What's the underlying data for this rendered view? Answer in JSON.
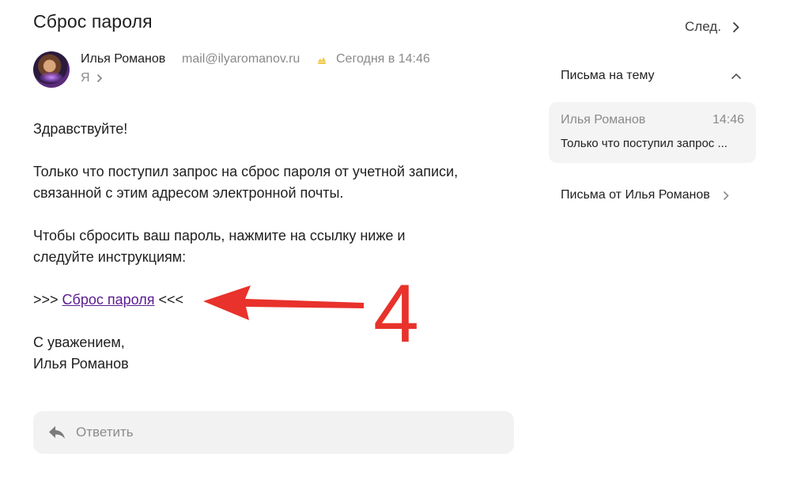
{
  "email": {
    "subject": "Сброс пароля",
    "sender_name": "Илья Романов",
    "sender_email": "mail@ilyaromanov.ru",
    "date": "Сегодня в 14:46",
    "recipient": "Я"
  },
  "body": {
    "greeting": "Здравствуйте!",
    "line1": "Только что поступил запрос на сброс пароля от учетной записи,",
    "line2": "связанной с этим адресом электронной почты.",
    "line3": "Чтобы сбросить ваш пароль, нажмите на ссылку ниже и",
    "line4": "следуйте инструкциям:",
    "link_prefix": ">>> ",
    "link_text": "Сброс пароля",
    "link_suffix": " <<<",
    "closing": "С уважением,",
    "signature": "Илья Романов"
  },
  "annotation": {
    "number": "4",
    "color": "#e8322b"
  },
  "reply": {
    "label": "Ответить"
  },
  "sidebar": {
    "next_label": "След.",
    "thread_header": "Письма на тему",
    "thread_item": {
      "from": "Илья Романов",
      "time": "14:46",
      "preview": "Только что поступил запрос ..."
    },
    "from_sender_label": "Письма от Илья Романов"
  },
  "colors": {
    "link": "#5a1c8f",
    "muted": "#8a8a8a",
    "verified_badge": "#f2c94c"
  }
}
